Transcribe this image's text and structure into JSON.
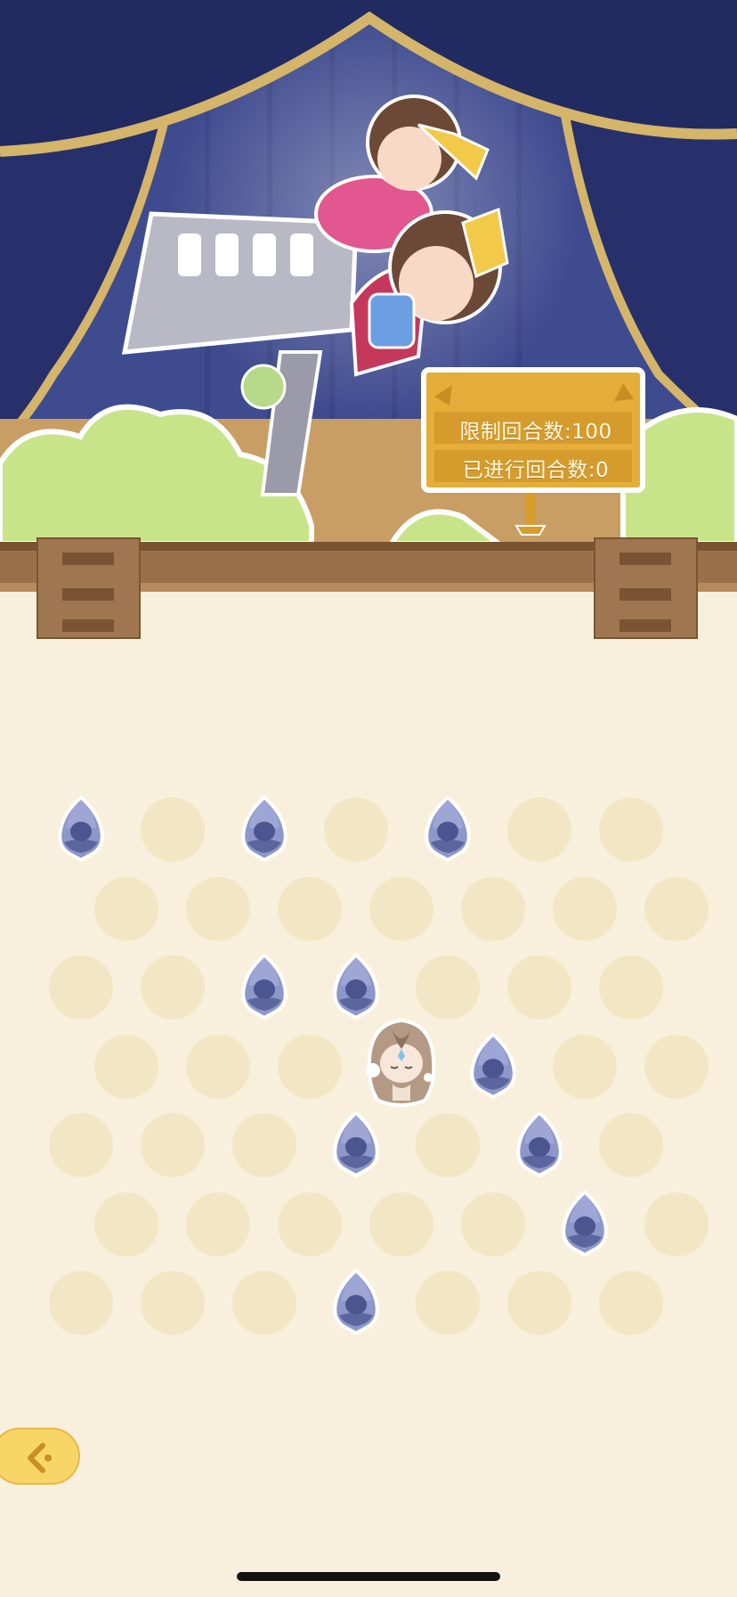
{
  "colors": {
    "background": "#f8f0dc",
    "cell": "#f2e6c4",
    "ghost_body": "#8d97c9",
    "ghost_dark": "#4b5690",
    "curtain": "#27306b",
    "curtain_trim": "#d4b56a",
    "sign": "#e5ae3a",
    "fence": "#9b7048",
    "back_button": "#f7d566"
  },
  "sign": {
    "limit_label": "限制回合数:100",
    "played_label": "已进行回合数:0"
  },
  "board": {
    "rows": 7,
    "cols": 7,
    "ghosts": [
      [
        0,
        0
      ],
      [
        0,
        2
      ],
      [
        0,
        4
      ],
      [
        2,
        2
      ],
      [
        2,
        3
      ],
      [
        3,
        4
      ],
      [
        4,
        3
      ],
      [
        4,
        5
      ],
      [
        5,
        5
      ],
      [
        6,
        3
      ]
    ],
    "player": [
      3,
      3
    ]
  },
  "icons": {
    "back": "back-arrow-icon",
    "ghost": "hooded-ghost-icon",
    "player": "girl-character-icon"
  }
}
